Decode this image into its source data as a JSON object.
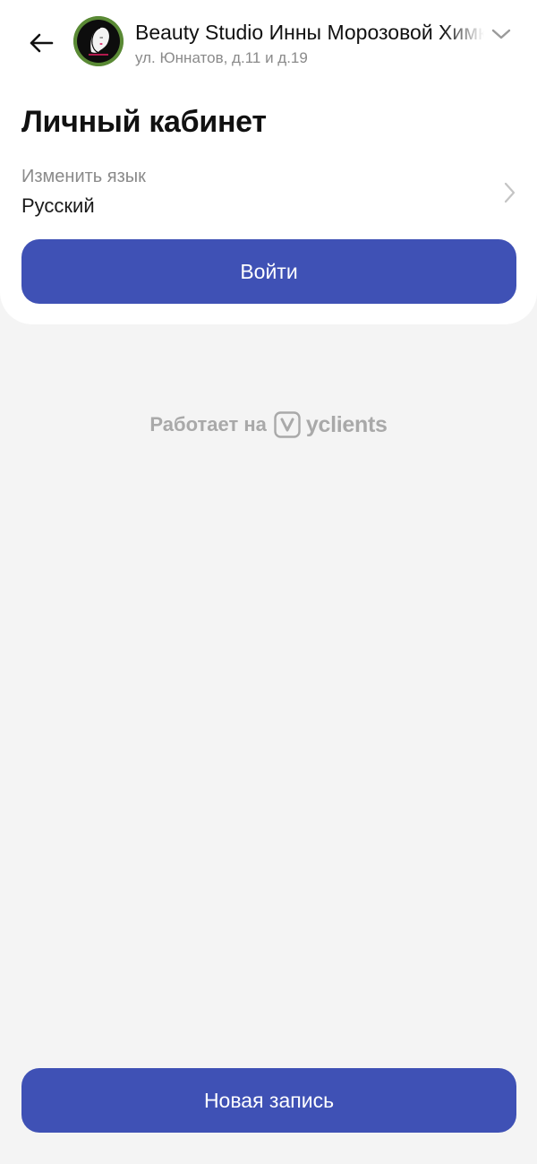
{
  "header": {
    "salon_name": "Beauty Studio Инны Морозовой Химки",
    "salon_address": "ул. Юннатов, д.11 и д.19",
    "avatar_text": "Beauty Studio",
    "icons": {
      "back": "arrow-left-icon",
      "expand": "chevron-down-icon"
    }
  },
  "page": {
    "title": "Личный кабинет"
  },
  "language": {
    "label": "Изменить язык",
    "value": "Русский",
    "icon": "chevron-right-icon"
  },
  "buttons": {
    "login": "Войти",
    "new_booking": "Новая запись"
  },
  "footer": {
    "powered_by": "Работает на",
    "brand": "yclients"
  },
  "colors": {
    "primary": "#3f51b5",
    "background": "#f4f4f4",
    "card": "#ffffff",
    "muted_text": "#8a8a8a",
    "powered_text": "#a9a9a9"
  }
}
